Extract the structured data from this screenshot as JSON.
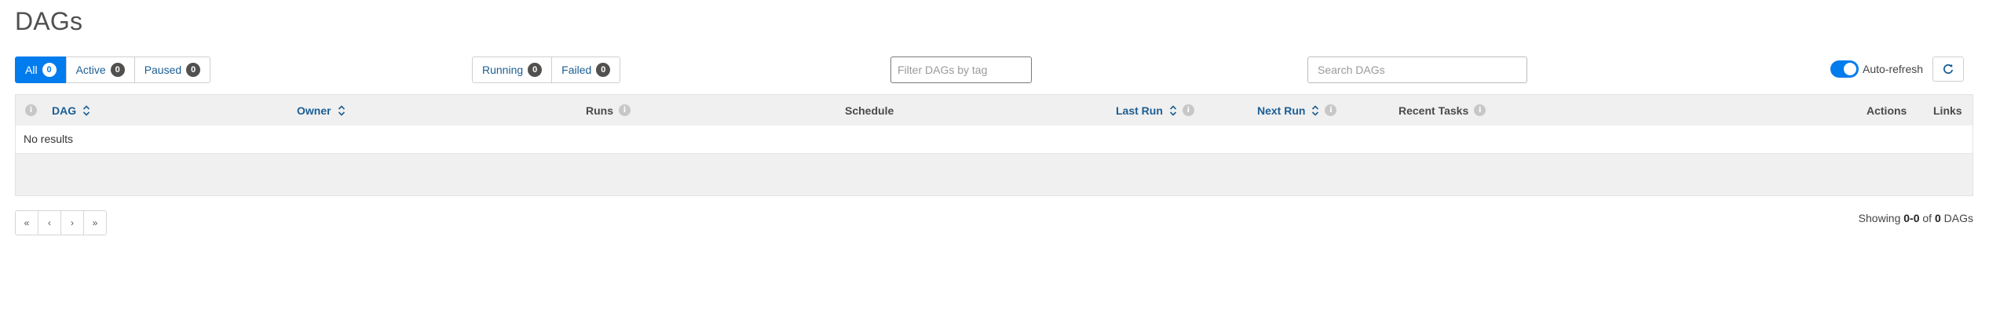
{
  "page": {
    "title": "DAGs"
  },
  "status_filter": [
    {
      "label": "All",
      "count": "0",
      "active": true
    },
    {
      "label": "Active",
      "count": "0",
      "active": false
    },
    {
      "label": "Paused",
      "count": "0",
      "active": false
    }
  ],
  "run_filter": [
    {
      "label": "Running",
      "count": "0"
    },
    {
      "label": "Failed",
      "count": "0"
    }
  ],
  "tag_filter": {
    "placeholder": "Filter DAGs by tag"
  },
  "search": {
    "placeholder": "Search DAGs"
  },
  "auto_refresh": {
    "label": "Auto-refresh",
    "enabled": true
  },
  "table": {
    "headers": {
      "dag": "DAG",
      "owner": "Owner",
      "runs": "Runs",
      "schedule": "Schedule",
      "last_run": "Last Run",
      "next_run": "Next Run",
      "recent_tasks": "Recent Tasks",
      "actions": "Actions",
      "links": "Links"
    },
    "empty_message": "No results"
  },
  "pagination": {
    "first": "«",
    "prev": "‹",
    "next": "›",
    "last": "»"
  },
  "summary": {
    "prefix": "Showing",
    "range": "0-0",
    "of": "of",
    "total": "0",
    "suffix": "DAGs"
  },
  "colors": {
    "accent": "#017cee",
    "link": "#1b5e94",
    "header_bg": "#f0f0f0"
  }
}
